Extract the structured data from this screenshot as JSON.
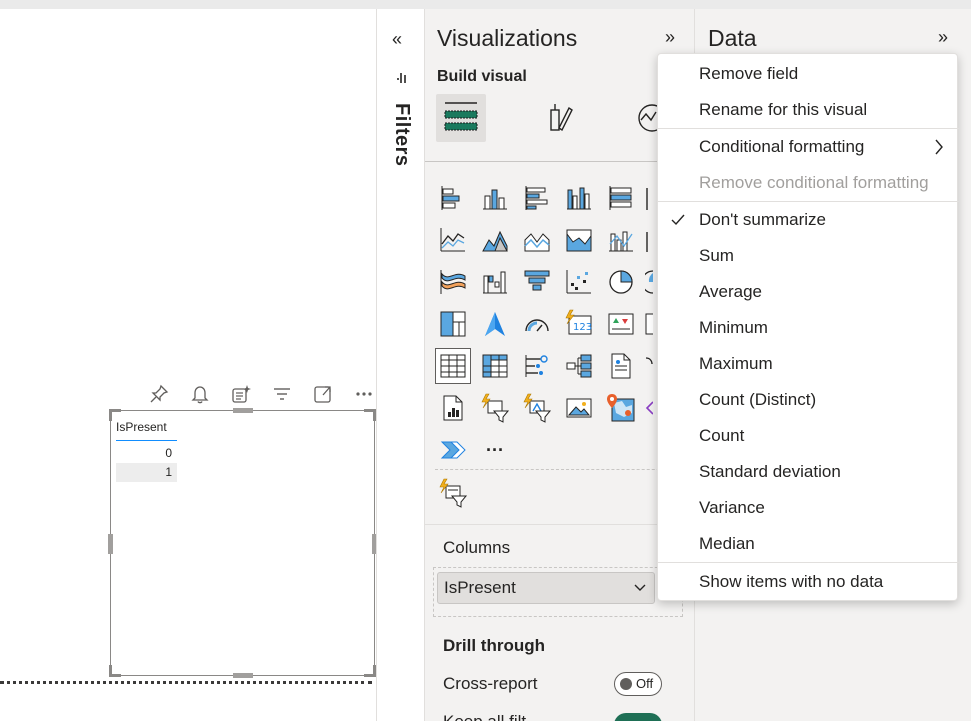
{
  "canvas": {
    "visual_table": {
      "header": "IsPresent",
      "rows": [
        "0",
        "1"
      ]
    },
    "visual_toolbar": [
      "pin-icon",
      "bell-icon",
      "smart-narrative-icon",
      "filter-icon",
      "focus-mode-icon",
      "more-options-icon"
    ]
  },
  "filters": {
    "label": "Filters",
    "collapse_glyph": "«"
  },
  "visualizations": {
    "title": "Visualizations",
    "expand_glyph": "»",
    "build_label": "Build visual",
    "columns_label": "Columns",
    "field": "IsPresent",
    "field_chevron": "⌄",
    "more_visuals": "···",
    "drill_through": "Drill through",
    "cross_report_label": "Cross-report",
    "cross_report_toggle": "Off",
    "keep_all_filters_label": "Keep all filt"
  },
  "data_pane": {
    "title": "Data",
    "expand_glyph": "»"
  },
  "context_menu": {
    "items": [
      {
        "label": "Remove field"
      },
      {
        "label": "Rename for this visual"
      },
      {
        "label": "Conditional formatting",
        "submenu": "›"
      },
      {
        "label": "Remove conditional formatting",
        "disabled": true
      },
      {
        "label": "Don't summarize",
        "checked": "✓"
      },
      {
        "label": "Sum"
      },
      {
        "label": "Average"
      },
      {
        "label": "Minimum"
      },
      {
        "label": "Maximum"
      },
      {
        "label": "Count (Distinct)"
      },
      {
        "label": "Count"
      },
      {
        "label": "Standard deviation"
      },
      {
        "label": "Variance"
      },
      {
        "label": "Median"
      },
      {
        "label": "Show items with no data"
      }
    ]
  },
  "colors": {
    "accent_blue": "#118dff",
    "toggle_on": "#1e6f55",
    "pane_background": "#f3f2f1"
  }
}
